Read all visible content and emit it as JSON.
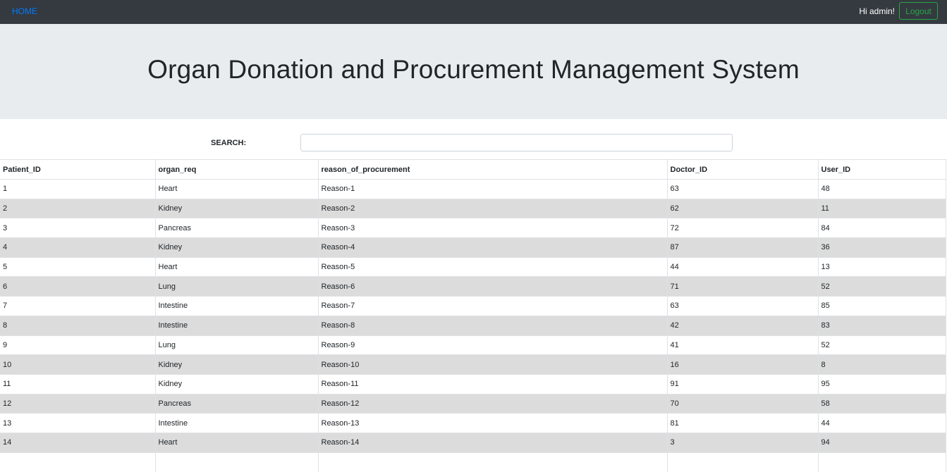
{
  "nav": {
    "home": "HOME",
    "greeting": "Hi admin!",
    "logout": "Logout"
  },
  "header": {
    "title": "Organ Donation and Procurement Management System"
  },
  "search": {
    "label": "SEARCH:",
    "value": ""
  },
  "table": {
    "columns": [
      "Patient_ID",
      "organ_req",
      "reason_of_procurement",
      "Doctor_ID",
      "User_ID"
    ],
    "rows": [
      [
        "1",
        "Heart",
        "Reason-1",
        "63",
        "48"
      ],
      [
        "2",
        "Kidney",
        "Reason-2",
        "62",
        "11"
      ],
      [
        "3",
        "Pancreas",
        "Reason-3",
        "72",
        "84"
      ],
      [
        "4",
        "Kidney",
        "Reason-4",
        "87",
        "36"
      ],
      [
        "5",
        "Heart",
        "Reason-5",
        "44",
        "13"
      ],
      [
        "6",
        "Lung",
        "Reason-6",
        "71",
        "52"
      ],
      [
        "7",
        "Intestine",
        "Reason-7",
        "63",
        "85"
      ],
      [
        "8",
        "Intestine",
        "Reason-8",
        "42",
        "83"
      ],
      [
        "9",
        "Lung",
        "Reason-9",
        "41",
        "52"
      ],
      [
        "10",
        "Kidney",
        "Reason-10",
        "16",
        "8"
      ],
      [
        "11",
        "Kidney",
        "Reason-11",
        "91",
        "95"
      ],
      [
        "12",
        "Pancreas",
        "Reason-12",
        "70",
        "58"
      ],
      [
        "13",
        "Intestine",
        "Reason-13",
        "81",
        "44"
      ],
      [
        "14",
        "Heart",
        "Reason-14",
        "3",
        "94"
      ],
      [
        "",
        "",
        "",
        "",
        ""
      ]
    ]
  },
  "colors": {
    "navbar": "#343a40",
    "link": "#007bff",
    "logout": "#28a745",
    "jumbotron": "#e9ecef",
    "stripe": "#dcdcdc"
  }
}
